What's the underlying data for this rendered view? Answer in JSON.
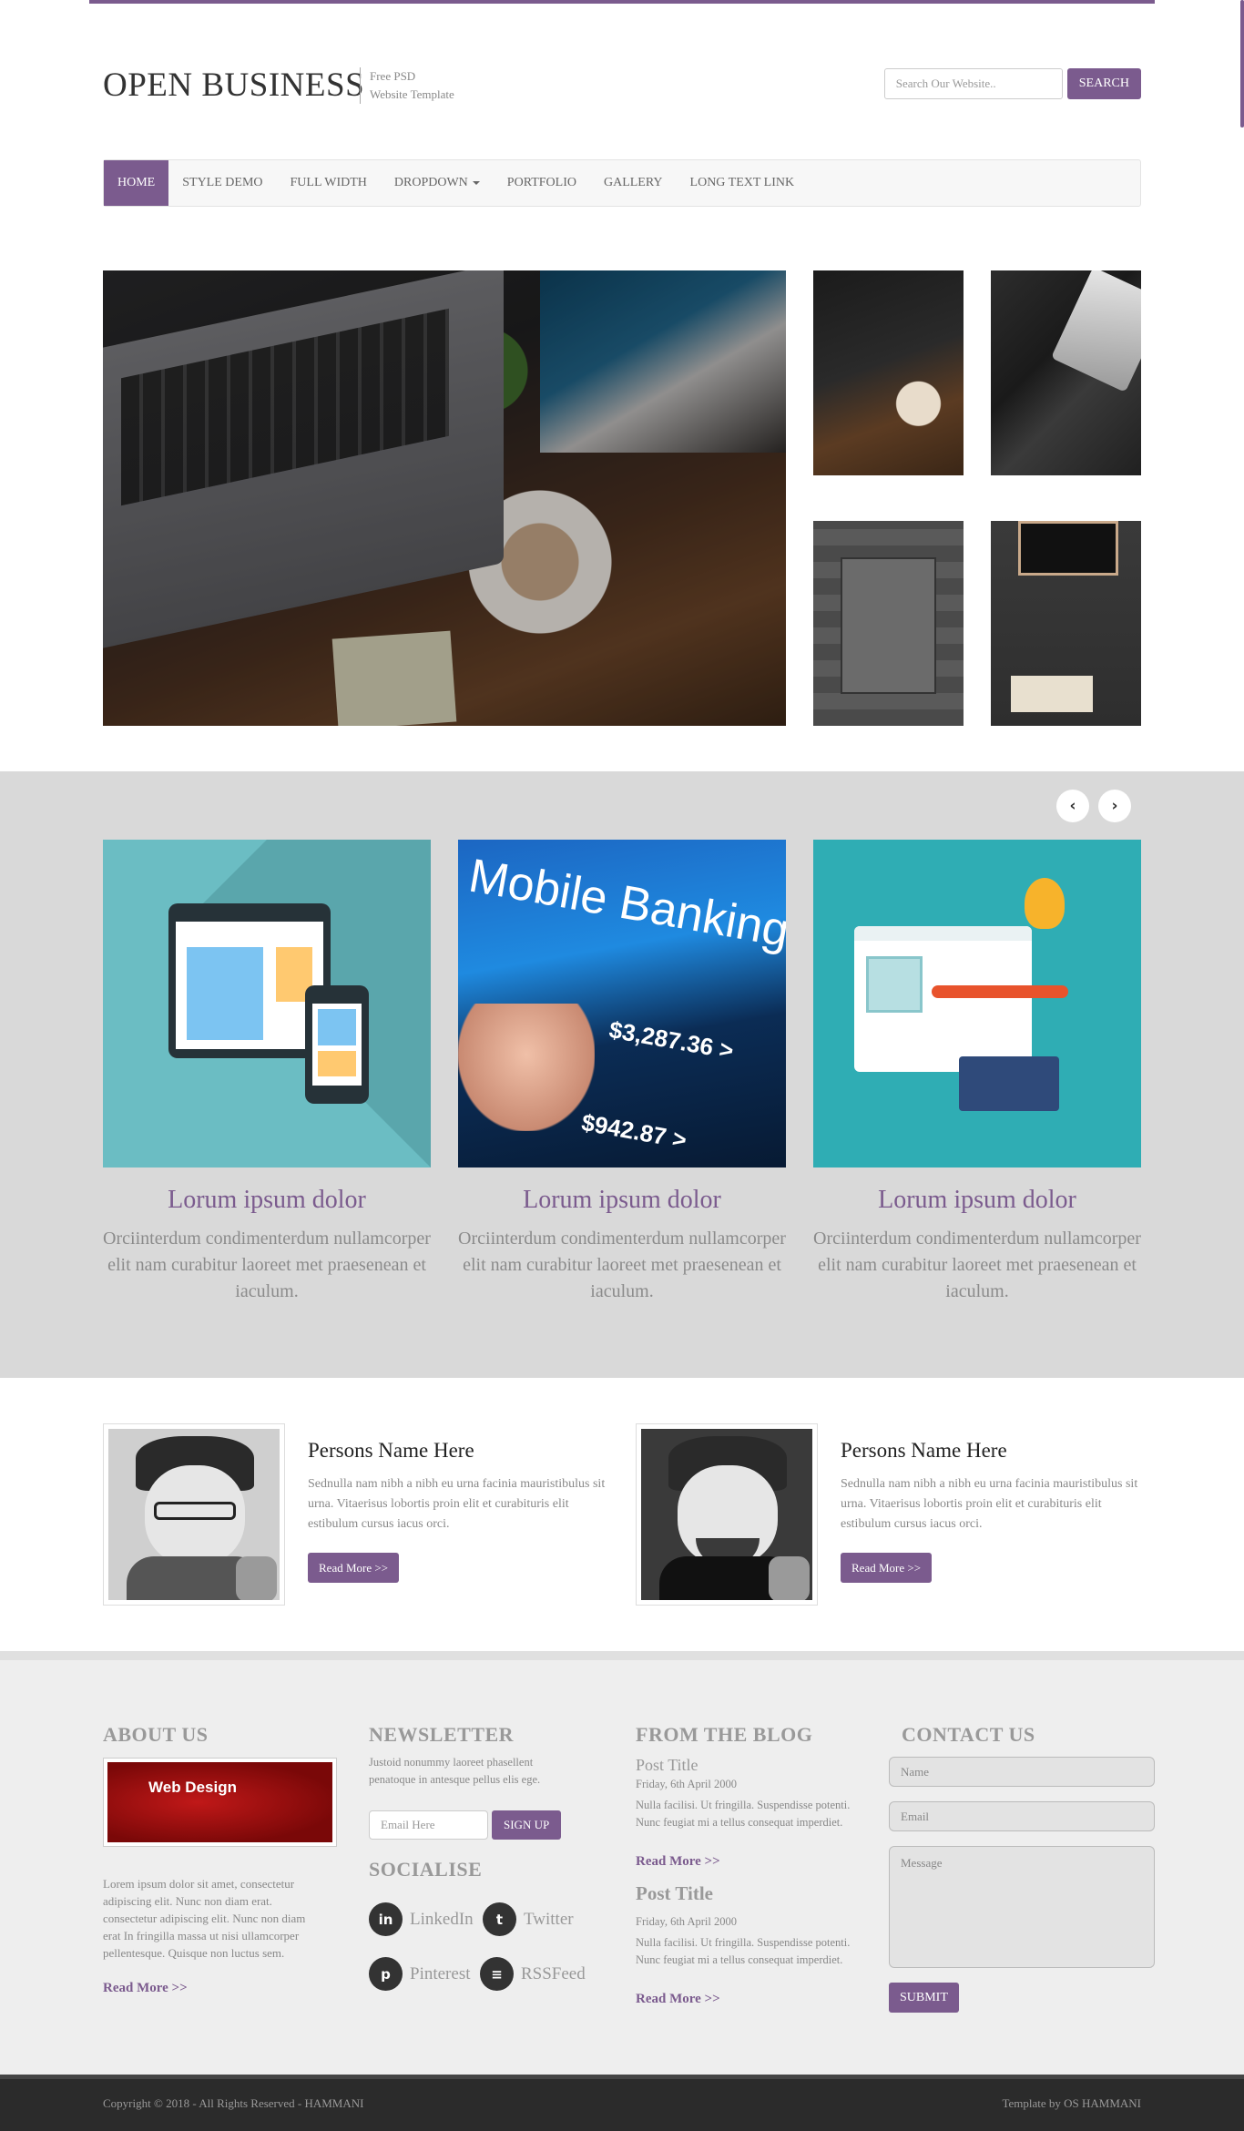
{
  "site": {
    "logo": "OPEN BUSINESS",
    "tagline_line1": "Free PSD",
    "tagline_line2": "Website Template"
  },
  "search": {
    "placeholder": "Search Our Website..",
    "button": "SEARCH"
  },
  "nav": {
    "items": [
      "HOME",
      "STYLE DEMO",
      "FULL WIDTH",
      "DROPDOWN",
      "PORTFOLIO",
      "GALLERY",
      "LONG TEXT LINK"
    ],
    "active": "HOME"
  },
  "features": {
    "prev_icon": "chevron-left-icon",
    "next_icon": "chevron-right-icon",
    "items": [
      {
        "title": "Lorum ipsum dolor",
        "text": "Orciinterdum condimenterdum nullamcorper elit nam curabitur laoreet met praesenean et iaculum."
      },
      {
        "title": "Lorum ipsum dolor",
        "text": "Orciinterdum condimenterdum nullamcorper elit nam curabitur laoreet met praesenean et iaculum."
      },
      {
        "title": "Lorum ipsum dolor",
        "text": "Orciinterdum condimenterdum nullamcorper elit nam curabitur laoreet met praesenean et iaculum."
      }
    ],
    "image_text": {
      "mobile_banking": "Mobile Banking",
      "amount1": "$3,287.36 >",
      "amount2": "$942.87 >",
      "web_design": "Web Design"
    }
  },
  "persons": [
    {
      "name": "Persons Name Here",
      "text": "Sednulla nam nibh a nibh eu urna facinia mauristibulus sit urna. Vitaerisus lobortis proin elit et curabituris elit estibulum cursus iacus orci.",
      "button": "Read More >>"
    },
    {
      "name": "Persons Name Here",
      "text": "Sednulla nam nibh a nibh eu urna facinia mauristibulus sit urna. Vitaerisus lobortis proin elit et curabituris elit estibulum cursus iacus orci.",
      "button": "Read More >>"
    }
  ],
  "footer": {
    "about": {
      "heading": "ABOUT US",
      "text": "Lorem ipsum dolor sit amet, consectetur adipiscing elit. Nunc non diam erat. consectetur adipiscing elit. Nunc non diam erat In fringilla massa ut nisi ullamcorper pellentesque. Quisque non luctus sem.",
      "link": "Read More >>"
    },
    "newsletter": {
      "heading": "NEWSLETTER",
      "text": "Justoid nonummy laoreet phasellent penatoque in antesque pellus elis ege.",
      "placeholder": "Email Here",
      "button": "SIGN UP"
    },
    "socialise": {
      "heading": "SOCIALISE",
      "items": [
        {
          "label": "LinkedIn",
          "icon": "linkedin-icon",
          "glyph": "in"
        },
        {
          "label": "Twitter",
          "icon": "twitter-icon",
          "glyph": "t"
        },
        {
          "label": "Pinterest",
          "icon": "pinterest-icon",
          "glyph": "p"
        },
        {
          "label": "RSSFeed",
          "icon": "rss-icon",
          "glyph": "≡"
        }
      ]
    },
    "blog": {
      "heading": "FROM THE BLOG",
      "posts": [
        {
          "title": "Post Title",
          "date": "Friday, 6th April 2000",
          "text": "Nulla facilisi. Ut fringilla. Suspendisse potenti. Nunc feugiat mi a tellus consequat imperdiet.",
          "link": "Read More >>"
        },
        {
          "title": "Post Title",
          "date": "Friday, 6th April 2000",
          "text": "Nulla facilisi. Ut fringilla. Suspendisse potenti. Nunc feugiat mi a tellus consequat imperdiet.",
          "link": "Read More >>"
        }
      ]
    },
    "contact": {
      "heading": "CONTACT US",
      "name_placeholder": "Name",
      "email_placeholder": "Email",
      "message_placeholder": "Message",
      "button": "SUBMIT"
    }
  },
  "bottom": {
    "copyright": "Copyright © 2018 - All Rights Reserved - HAMMANI",
    "credit": "Template by OS HAMMANI"
  },
  "colors": {
    "accent": "#7b5b8e",
    "band_bg": "#d9d9d9",
    "footer_bg": "#eeeeee",
    "bottom_bg": "#2b2b2b"
  }
}
